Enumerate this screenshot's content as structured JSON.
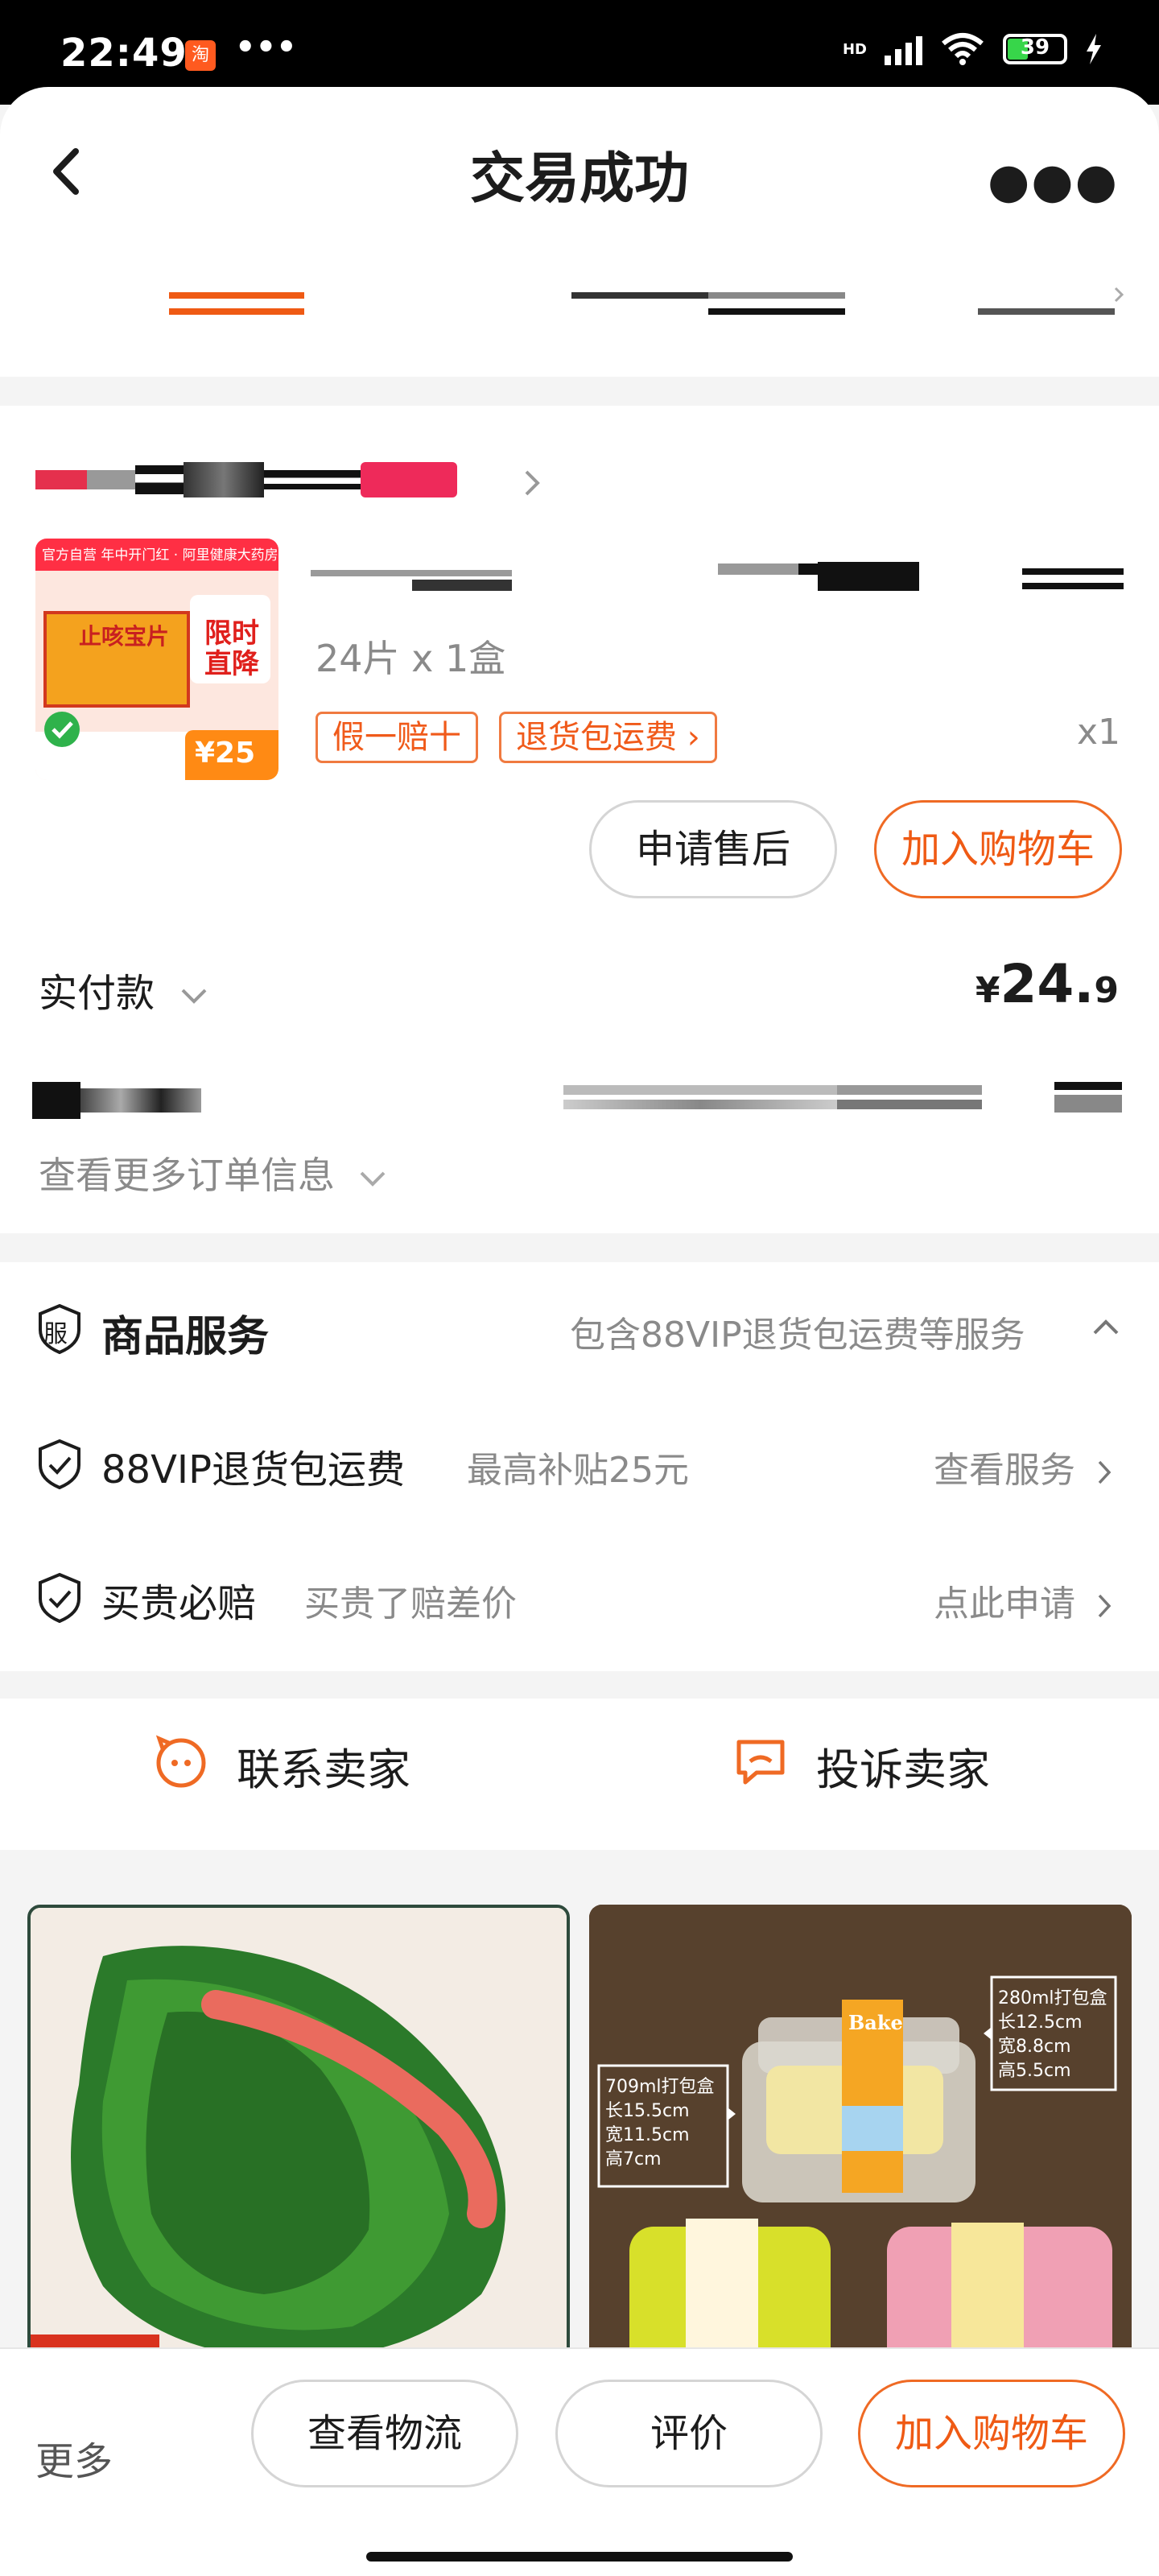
{
  "status_bar": {
    "time": "22:49",
    "app_badge": "淘",
    "more": "•••",
    "network": "HD",
    "battery": "39"
  },
  "header": {
    "title": "交易成功"
  },
  "order": {
    "product": {
      "image_label": "止咳宝片",
      "image_banner": "官方自营  年中开门红 · 阿里健康大药房",
      "image_promo_1": "限时",
      "image_promo_2": "直降",
      "image_price": "¥25",
      "spec": "24片 x 1盒",
      "tags": [
        "假一赔十",
        "退货包运费 ›"
      ],
      "quantity": "x1"
    },
    "buttons": {
      "after_sale": "申请售后",
      "add_to_cart": "加入购物车"
    },
    "paid": {
      "label": "实付款",
      "currency": "¥",
      "integer": "24.",
      "decimal": "9"
    },
    "more_info": "查看更多订单信息"
  },
  "services": {
    "header": {
      "icon_text": "服",
      "title": "商品服务",
      "summary": "包含88VIP退货包运费等服务"
    },
    "items": [
      {
        "title": "88VIP退货包运费",
        "subtitle": "最高补贴25元",
        "link": "查看服务"
      },
      {
        "title": "买贵必赔",
        "subtitle": "买贵了赔差价",
        "link": "点此申请"
      }
    ]
  },
  "contact": {
    "seller": "联系卖家",
    "complain": "投诉卖家"
  },
  "recommendations": [
    {
      "kind": "seaweed"
    },
    {
      "kind": "boxes",
      "label_brand": "Bake",
      "label_a_title": "280ml打包盒",
      "label_a_l": "长12.5cm",
      "label_a_w": "宽8.8cm",
      "label_a_h": "高5.5cm",
      "label_b_title": "709ml打包盒",
      "label_b_l": "长15.5cm",
      "label_b_w": "宽11.5cm",
      "label_b_h": "高7cm"
    }
  ],
  "bottom_bar": {
    "more": "更多",
    "logistics": "查看物流",
    "review": "评价",
    "add_to_cart": "加入购物车"
  },
  "colors": {
    "accent": "#ef5a14",
    "text_grey": "#8a8a8a",
    "bg": "#f4f4f4"
  }
}
